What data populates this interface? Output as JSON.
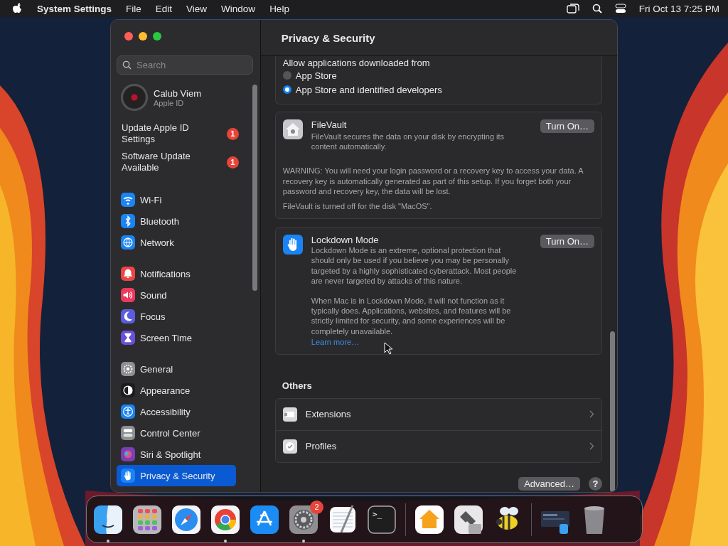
{
  "menu_bar": {
    "app_name": "System Settings",
    "menus": [
      "File",
      "Edit",
      "View",
      "Window",
      "Help"
    ],
    "clock": "Fri Oct 13  7:25 PM"
  },
  "sidebar": {
    "search": {
      "placeholder": "Search"
    },
    "account": {
      "name": "Calub Viem",
      "subtitle": "Apple ID"
    },
    "alerts": [
      {
        "label": "Update Apple ID Settings",
        "badge": "1"
      },
      {
        "label": "Software Update Available",
        "badge": "1"
      }
    ],
    "groups": [
      [
        {
          "label": "Wi-Fi",
          "color": "#1a84f5",
          "selected": false
        },
        {
          "label": "Bluetooth",
          "color": "#1a84f5",
          "selected": false
        },
        {
          "label": "Network",
          "color": "#1a84f5",
          "selected": false
        }
      ],
      [
        {
          "label": "Notifications",
          "color": "#ec4545",
          "selected": false
        },
        {
          "label": "Sound",
          "color": "#ec3a5c",
          "selected": false
        },
        {
          "label": "Focus",
          "color": "#5c5ce0",
          "selected": false
        },
        {
          "label": "Screen Time",
          "color": "#6a4fd8",
          "selected": false
        }
      ],
      [
        {
          "label": "General",
          "color": "#8e8e93",
          "selected": false
        },
        {
          "label": "Appearance",
          "color": "#1c1c1e",
          "selected": false
        },
        {
          "label": "Accessibility",
          "color": "#1a84f5",
          "selected": false
        },
        {
          "label": "Control Center",
          "color": "#8e8e93",
          "selected": false
        },
        {
          "label": "Siri & Spotlight",
          "color": "#7a3fb0",
          "selected": false
        },
        {
          "label": "Privacy & Security",
          "color": "#1a84f5",
          "selected": true
        }
      ]
    ]
  },
  "content": {
    "title": "Privacy & Security",
    "allow_apps": {
      "heading": "Allow applications downloaded from",
      "options": [
        {
          "label": "App Store",
          "selected": false
        },
        {
          "label": "App Store and identified developers",
          "selected": true
        }
      ]
    },
    "filevault": {
      "title": "FileVault",
      "description": "FileVault secures the data on your disk by encrypting its content automatically.",
      "button": "Turn On…",
      "warning": "WARNING: You will need your login password or a recovery key to access your data. A recovery key is automatically generated as part of this setup. If you forget both your password and recovery key, the data will be lost.",
      "status": "FileVault is turned off for the disk \"MacOS\"."
    },
    "lockdown": {
      "title": "Lockdown Mode",
      "description": "Lockdown Mode is an extreme, optional protection that should only be used if you believe you may be personally targeted by a highly sophisticated cyberattack. Most people are never targeted by attacks of this nature.",
      "description_2": "When Mac is in Lockdown Mode, it will not function as it typically does. Applications, websites, and features will be strictly limited for security, and some experiences will be completely unavailable.",
      "link": "Learn more…",
      "button": "Turn On…"
    },
    "others": {
      "heading": "Others",
      "rows": [
        "Extensions",
        "Profiles"
      ]
    },
    "advanced_button": "Advanced…",
    "help_button": "?"
  },
  "dock": {
    "items": [
      {
        "running": true
      },
      {
        "running": false
      },
      {
        "running": false
      },
      {
        "running": true
      },
      {
        "running": false
      },
      {
        "running": true,
        "badge": "2"
      },
      {
        "running": false
      },
      {
        "running": false,
        "glyph": ">_"
      },
      {
        "running": false
      },
      {
        "running": false
      },
      {
        "running": false
      },
      {
        "running": false
      },
      {
        "running": false
      }
    ]
  }
}
